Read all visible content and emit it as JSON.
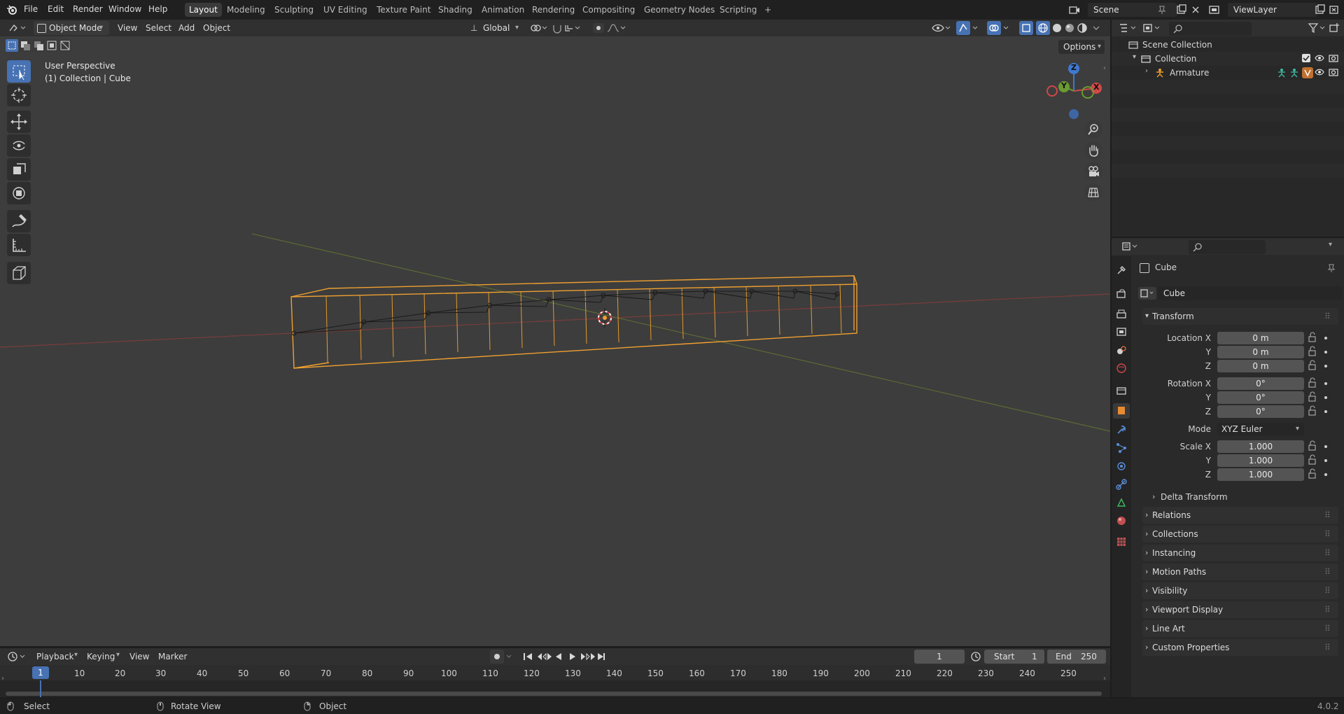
{
  "topbar": {
    "menus": [
      "File",
      "Edit",
      "Render",
      "Window",
      "Help"
    ],
    "workspaces": [
      "Layout",
      "Modeling",
      "Sculpting",
      "UV Editing",
      "Texture Paint",
      "Shading",
      "Animation",
      "Rendering",
      "Compositing",
      "Geometry Nodes",
      "Scripting"
    ],
    "active_workspace": "Layout",
    "add_tab": "+",
    "scene": "Scene",
    "view_layer": "ViewLayer"
  },
  "viewport_header": {
    "mode": "Object Mode",
    "menus": [
      "View",
      "Select",
      "Add",
      "Object"
    ],
    "transform_orientation": "Global",
    "options": "Options"
  },
  "viewport": {
    "title": "User Perspective",
    "subtitle": "(1) Collection | Cube",
    "gizmo_labels": {
      "z": "Z",
      "y": "Y",
      "x": "X"
    }
  },
  "outliner": {
    "root": "Scene Collection",
    "collection": "Collection",
    "armature": "Armature"
  },
  "properties": {
    "object_name": "Cube",
    "data_name": "Cube",
    "transform_title": "Transform",
    "location_label": "Location X",
    "rotation_label": "Rotation X",
    "scale_label": "Scale X",
    "y_label": "Y",
    "z_label": "Z",
    "location": [
      "0 m",
      "0 m",
      "0 m"
    ],
    "rotation": [
      "0°",
      "0°",
      "0°"
    ],
    "mode_label": "Mode",
    "mode_value": "XYZ Euler",
    "scale": [
      "1.000",
      "1.000",
      "1.000"
    ],
    "delta": "Delta Transform",
    "panels": [
      "Relations",
      "Collections",
      "Instancing",
      "Motion Paths",
      "Visibility",
      "Viewport Display",
      "Line Art",
      "Custom Properties"
    ]
  },
  "timeline": {
    "menus": [
      "Playback",
      "Keying",
      "View",
      "Marker"
    ],
    "current_frame": "1",
    "start_label": "Start",
    "start": "1",
    "end_label": "End",
    "end": "250",
    "ticks": [
      "1",
      "10",
      "20",
      "30",
      "40",
      "50",
      "60",
      "70",
      "80",
      "90",
      "100",
      "110",
      "120",
      "130",
      "140",
      "150",
      "160",
      "170",
      "180",
      "190",
      "200",
      "210",
      "220",
      "230",
      "240",
      "250"
    ]
  },
  "statusbar": {
    "select": "Select",
    "rotate": "Rotate View",
    "object": "Object",
    "version": "4.0.2"
  }
}
